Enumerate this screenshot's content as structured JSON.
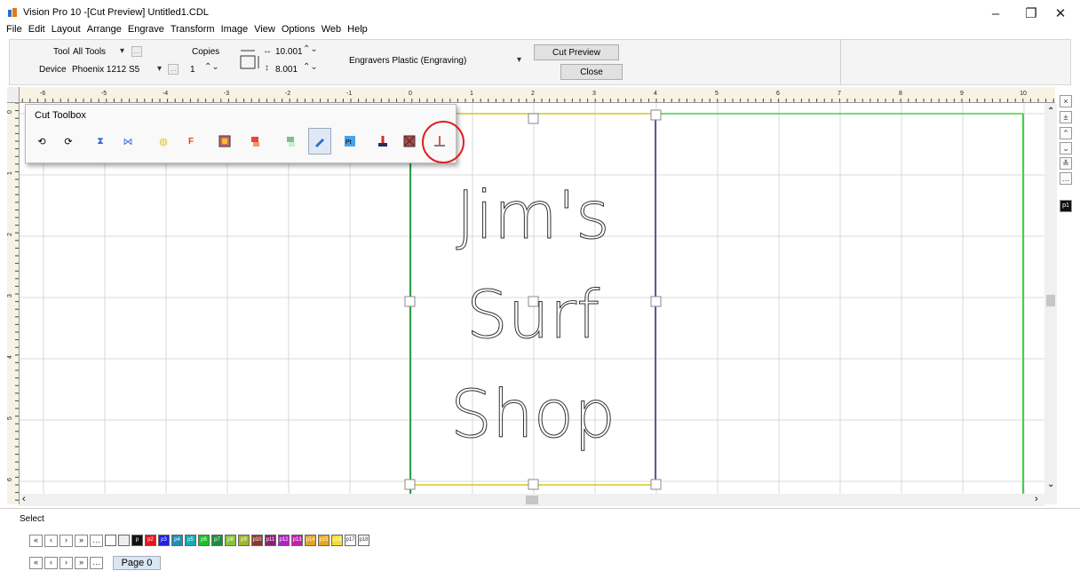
{
  "window": {
    "title": "Vision Pro 10 -[Cut Preview] Untitled1.CDL",
    "minimize": "–",
    "restore": "❐",
    "close": "✕"
  },
  "menu": [
    "File",
    "Edit",
    "Layout",
    "Arrange",
    "Engrave",
    "Transform",
    "Image",
    "View",
    "Options",
    "Web",
    "Help"
  ],
  "toolbar": {
    "tool_label": "Tool",
    "tool_value": "All Tools",
    "device_label": "Device",
    "device_value": "Phoenix 1212 S5",
    "copies_label": "Copies",
    "copies_value": "1",
    "width_value": "10.001",
    "height_value": "8.001",
    "material_value": "Engravers Plastic (Engraving)",
    "cut_preview_label": "Cut Preview",
    "close_label": "Close",
    "browse_label": "..."
  },
  "ruler": {
    "h_labels": [
      "-6",
      "-5",
      "-4",
      "-3",
      "-2",
      "-1",
      "0",
      "1",
      "2",
      "3",
      "4",
      "5",
      "6",
      "7",
      "8",
      "9",
      "10"
    ],
    "v_labels": [
      "0",
      "1",
      "2",
      "3",
      "4",
      "5",
      "6"
    ]
  },
  "cut_toolbox": {
    "title": "Cut Toolbox",
    "icons": [
      "rotate-ccw-icon",
      "rotate-cw-icon",
      "mirror-vertical-icon",
      "mirror-horizontal-icon",
      "bulb-icon",
      "font-icon",
      "image-icon",
      "color-fill-icon",
      "color-fill-light-icon",
      "paint-icon",
      "paint-text-icon",
      "paint-bucket-icon",
      "cancel-image-icon",
      "depth-tool-icon"
    ]
  },
  "canvas": {
    "text_lines": [
      "Jim's",
      "Surf",
      "Shop"
    ]
  },
  "right_tools": [
    "×",
    "±",
    "⌃",
    "⌄",
    "≚",
    "…"
  ],
  "right_page_icon": "p1",
  "status": {
    "mode": "Select"
  },
  "colors": {
    "swatches": [
      {
        "label": "",
        "color": "#ffffff"
      },
      {
        "label": "",
        "color": "#eeeeee"
      },
      {
        "label": "p",
        "color": "#111111"
      },
      {
        "label": "p2",
        "color": "#e8141c"
      },
      {
        "label": "p3",
        "color": "#1d21e6"
      },
      {
        "label": "p4",
        "color": "#1f8fb8"
      },
      {
        "label": "p5",
        "color": "#16a9b5"
      },
      {
        "label": "p6",
        "color": "#17c223"
      },
      {
        "label": "p7",
        "color": "#1b8e3a"
      },
      {
        "label": "p8",
        "color": "#88c23d"
      },
      {
        "label": "p9",
        "color": "#a4b52c"
      },
      {
        "label": "p10",
        "color": "#8a3a2b"
      },
      {
        "label": "p11",
        "color": "#8d1f70"
      },
      {
        "label": "p12",
        "color": "#b421c8"
      },
      {
        "label": "p13",
        "color": "#c021a8"
      },
      {
        "label": "p14",
        "color": "#e0a327"
      },
      {
        "label": "p15",
        "color": "#e8a71f"
      },
      {
        "label": "p16",
        "color": "#f3dd2f"
      },
      {
        "label": "p17",
        "color": "#ffffff"
      },
      {
        "label": "p18",
        "color": "#ffffff"
      }
    ]
  },
  "nav_buttons": [
    "«",
    "‹",
    "›",
    "»",
    "…"
  ],
  "page_tab": "Page 0"
}
